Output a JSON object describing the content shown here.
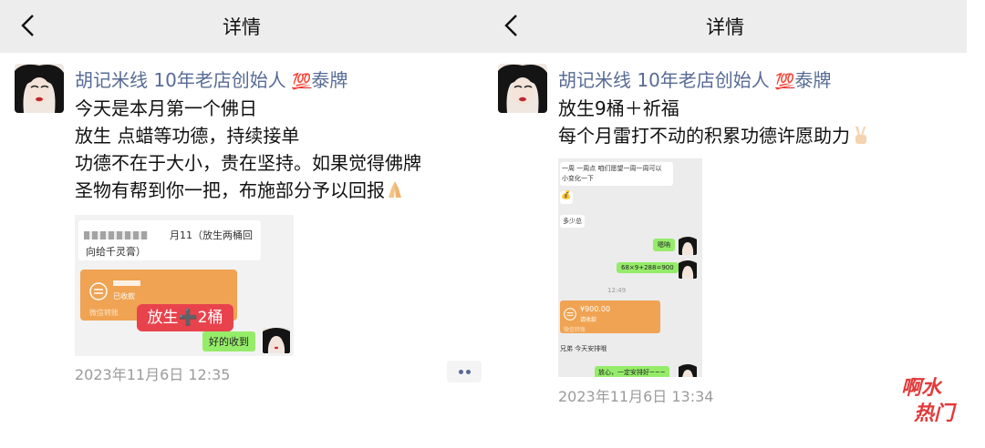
{
  "left": {
    "header_title": "详情",
    "author_name": "胡记米线 10年老店创始人",
    "author_badge": "💯",
    "author_suffix": "泰牌",
    "post_lines": [
      "今天是本月第一个佛日",
      "放生 点蜡等功德，持续接单",
      "功德不在于大小，贵在坚持。如果觉得佛牌",
      "圣物有帮到你一把，布施部分予以回报"
    ],
    "image_chat": {
      "top_text_line1": "月11（放生两桶回",
      "top_text_line2": "向给千灵膏）",
      "transfer_label": "已收款",
      "transfer_footer": "微信转账",
      "overlay_label": "放生➕2桶",
      "reply": "好的收到"
    },
    "date": "2023年11月6日 12:35"
  },
  "right": {
    "header_title": "详情",
    "author_name": "胡记米线 10年老店创始人",
    "author_badge": "💯",
    "author_suffix": "泰牌",
    "post_lines": [
      "放生9桶＋祈福",
      "每个月雷打不动的积累功德许愿助力"
    ],
    "image_chat": {
      "msg1_line1": "一周 一周点 咱们愿望一周一周可以",
      "msg1_line2": "小变化一下",
      "msg2": "多少总",
      "reply1": "嗯呐",
      "reply2": "68×9+288=900",
      "time": "12:49",
      "transfer_amount": "¥900.00",
      "transfer_label": "请收款",
      "transfer_footer": "微信转账",
      "msg3": "兄弟 今天安排哦",
      "reply3": "放心，一定安排好~~~"
    },
    "date": "2023年11月6日 13:34"
  },
  "watermark": {
    "line1": "啊水",
    "line2": "热门"
  },
  "colors": {
    "name": "#576b95",
    "topbar": "#ededed",
    "date": "#9b9b9b",
    "wechat_green": "#95ec69",
    "transfer_orange": "#f0a352",
    "overlay_red": "#e8434d"
  },
  "icons": [
    "back-arrow-icon",
    "praying-hands-emoji",
    "victory-hand-emoji",
    "more-dots-icon"
  ]
}
